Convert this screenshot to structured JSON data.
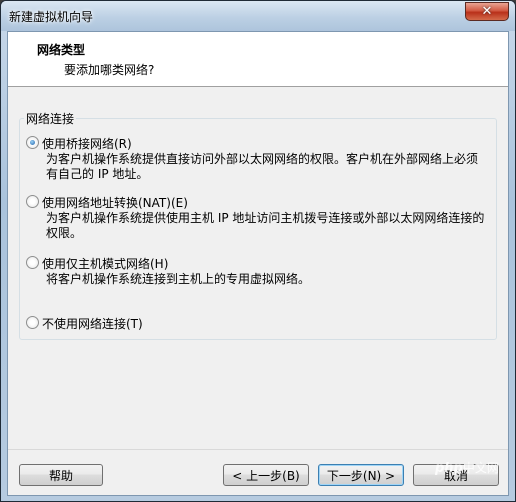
{
  "window": {
    "title": "新建虚拟机向导",
    "close_glyph": "✕"
  },
  "header": {
    "title": "网络类型",
    "subtitle": "要添加哪类网络?"
  },
  "group": {
    "label": "网络连接"
  },
  "options": [
    {
      "label": "使用桥接网络(R)",
      "checked": true,
      "desc": [
        "为客户机操作系统提供直接访问外部以太网网络的权限。客户机在外部网络上必须",
        "有自己的 IP 地址。"
      ]
    },
    {
      "label": "使用网络地址转换(NAT)(E)",
      "checked": false,
      "desc": [
        "为客户机操作系统提供使用主机 IP 地址访问主机拨号连接或外部以太网网络连接的",
        "权限。"
      ]
    },
    {
      "label": "使用仅主机模式网络(H)",
      "checked": false,
      "desc": [
        "将客户机操作系统连接到主机上的专用虚拟网络。"
      ]
    },
    {
      "label": "不使用网络连接(T)",
      "checked": false,
      "desc": []
    }
  ],
  "buttons": {
    "help": "帮助",
    "back": "< 上一步(B)",
    "next": "下一步(N) >",
    "cancel": "取消"
  },
  "watermark": {
    "brand": "php",
    "suffix": "中文网"
  }
}
